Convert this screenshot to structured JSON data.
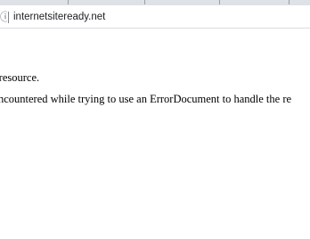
{
  "browser": {
    "address_bar": {
      "url": "internetsiteready.net",
      "info_icon": "info-icon"
    }
  },
  "page": {
    "message": "ccess this resource.",
    "error_detail": "rror was encountered while trying to use an ErrorDocument to handle the re"
  }
}
